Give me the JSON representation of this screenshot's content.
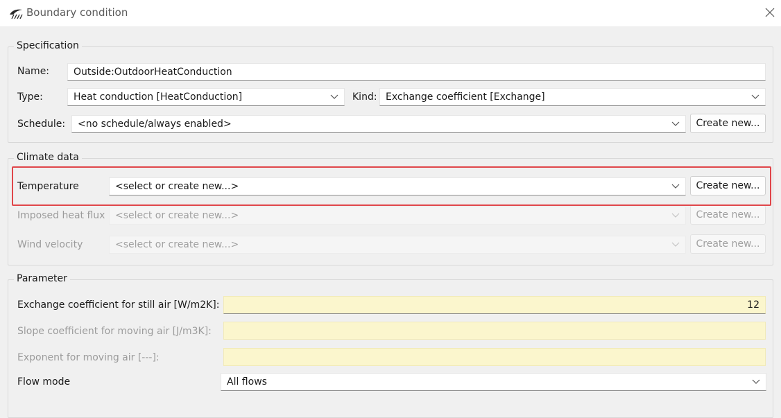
{
  "window": {
    "title": "Boundary condition"
  },
  "specification": {
    "legend": "Specification",
    "name_label": "Name:",
    "name_value": "Outside:OutdoorHeatConduction",
    "type_label": "Type:",
    "type_value": "Heat conduction [HeatConduction]",
    "kind_label": "Kind:",
    "kind_value": "Exchange coefficient [Exchange]",
    "schedule_label": "Schedule:",
    "schedule_value": "<no schedule/always enabled>",
    "create_new_label": "Create new..."
  },
  "climate": {
    "legend": "Climate data",
    "rows": [
      {
        "label": "Temperature",
        "value": "<select or create new...>",
        "button": "Create new..."
      },
      {
        "label": "Imposed heat flux",
        "value": "<select or create new...>",
        "button": "Create new..."
      },
      {
        "label": "Wind velocity",
        "value": "<select or create new...>",
        "button": "Create new..."
      }
    ]
  },
  "parameter": {
    "legend": "Parameter",
    "rows": [
      {
        "label": "Exchange coefficient for still air [W/m2K]:",
        "value": "12"
      },
      {
        "label": "Slope coefficient for moving air [J/m3K]:",
        "value": ""
      },
      {
        "label": "Exponent for moving air [---]:",
        "value": ""
      }
    ],
    "flow_mode_label": "Flow mode",
    "flow_mode_value": "All flows"
  },
  "colors": {
    "highlight": "#e0464a",
    "input_yellow": "#fbf6cd",
    "disabled_text": "#9b9b9b"
  }
}
